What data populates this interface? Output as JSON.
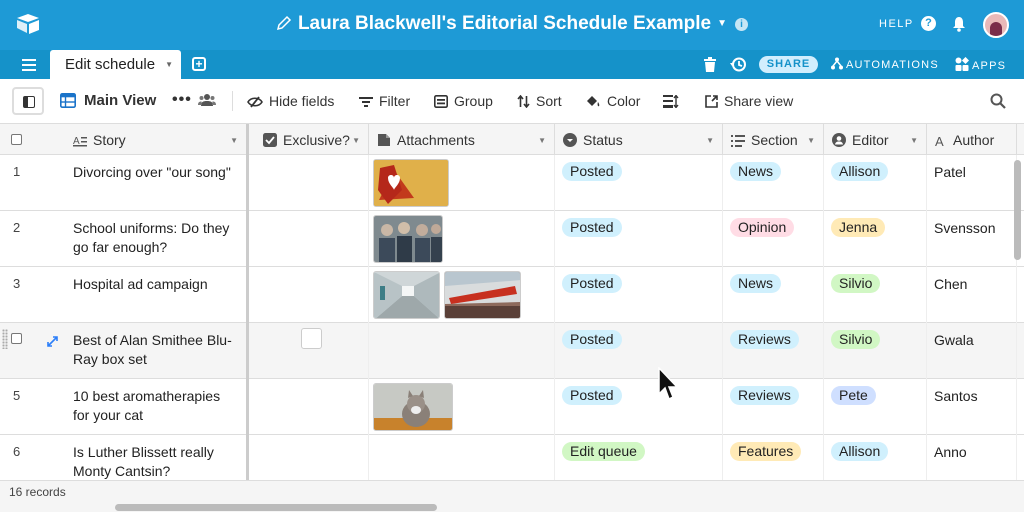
{
  "app": {
    "title": "Laura Blackwell's Editorial Schedule Example",
    "help_label": "HELP",
    "help_icon_glyph": "?"
  },
  "tabs": {
    "active_label": "Edit schedule",
    "share_label": "SHARE",
    "automations_label": "AUTOMATIONS",
    "apps_label": "APPS"
  },
  "toolbar": {
    "view_name": "Main View",
    "dots": "•••",
    "hide_fields": "Hide fields",
    "filter": "Filter",
    "group": "Group",
    "sort": "Sort",
    "color": "Color",
    "share_view": "Share view"
  },
  "columns": {
    "story": "Story",
    "exclusive": "Exclusive?",
    "attachments": "Attachments",
    "status": "Status",
    "section": "Section",
    "editor": "Editor",
    "author": "Author"
  },
  "rows": [
    {
      "num": "1",
      "story": "Divorcing over \"our song\"",
      "status": "Posted",
      "section": "News",
      "editor": "Allison",
      "author": "Patel"
    },
    {
      "num": "2",
      "story": "School uniforms: Do they go far enough?",
      "status": "Posted",
      "section": "Opinion",
      "editor": "Jenna",
      "author": "Svensson"
    },
    {
      "num": "3",
      "story": "Hospital ad campaign",
      "status": "Posted",
      "section": "News",
      "editor": "Silvio",
      "author": "Chen"
    },
    {
      "num": "",
      "story": "Best of Alan Smithee Blu-Ray box set",
      "status": "Posted",
      "section": "Reviews",
      "editor": "Silvio",
      "author": "Gwala"
    },
    {
      "num": "5",
      "story": "10 best aromatherapies for your cat",
      "status": "Posted",
      "section": "Reviews",
      "editor": "Pete",
      "author": "Santos"
    },
    {
      "num": "6",
      "story": "Is Luther Blissett really Monty Cantsin?",
      "status": "Edit queue",
      "section": "Features",
      "editor": "Allison",
      "author": "Anno"
    }
  ],
  "footer": {
    "records": "16 records"
  },
  "colors": {
    "topbar": "#1e9ad6",
    "tabbar": "#1592c9",
    "pill_blue": "#d0f0fd",
    "pill_pink": "#ffdce5",
    "pill_yellow": "#ffeab6",
    "pill_green": "#d1f7c4",
    "pill_periwinkle": "#cfdfff"
  }
}
